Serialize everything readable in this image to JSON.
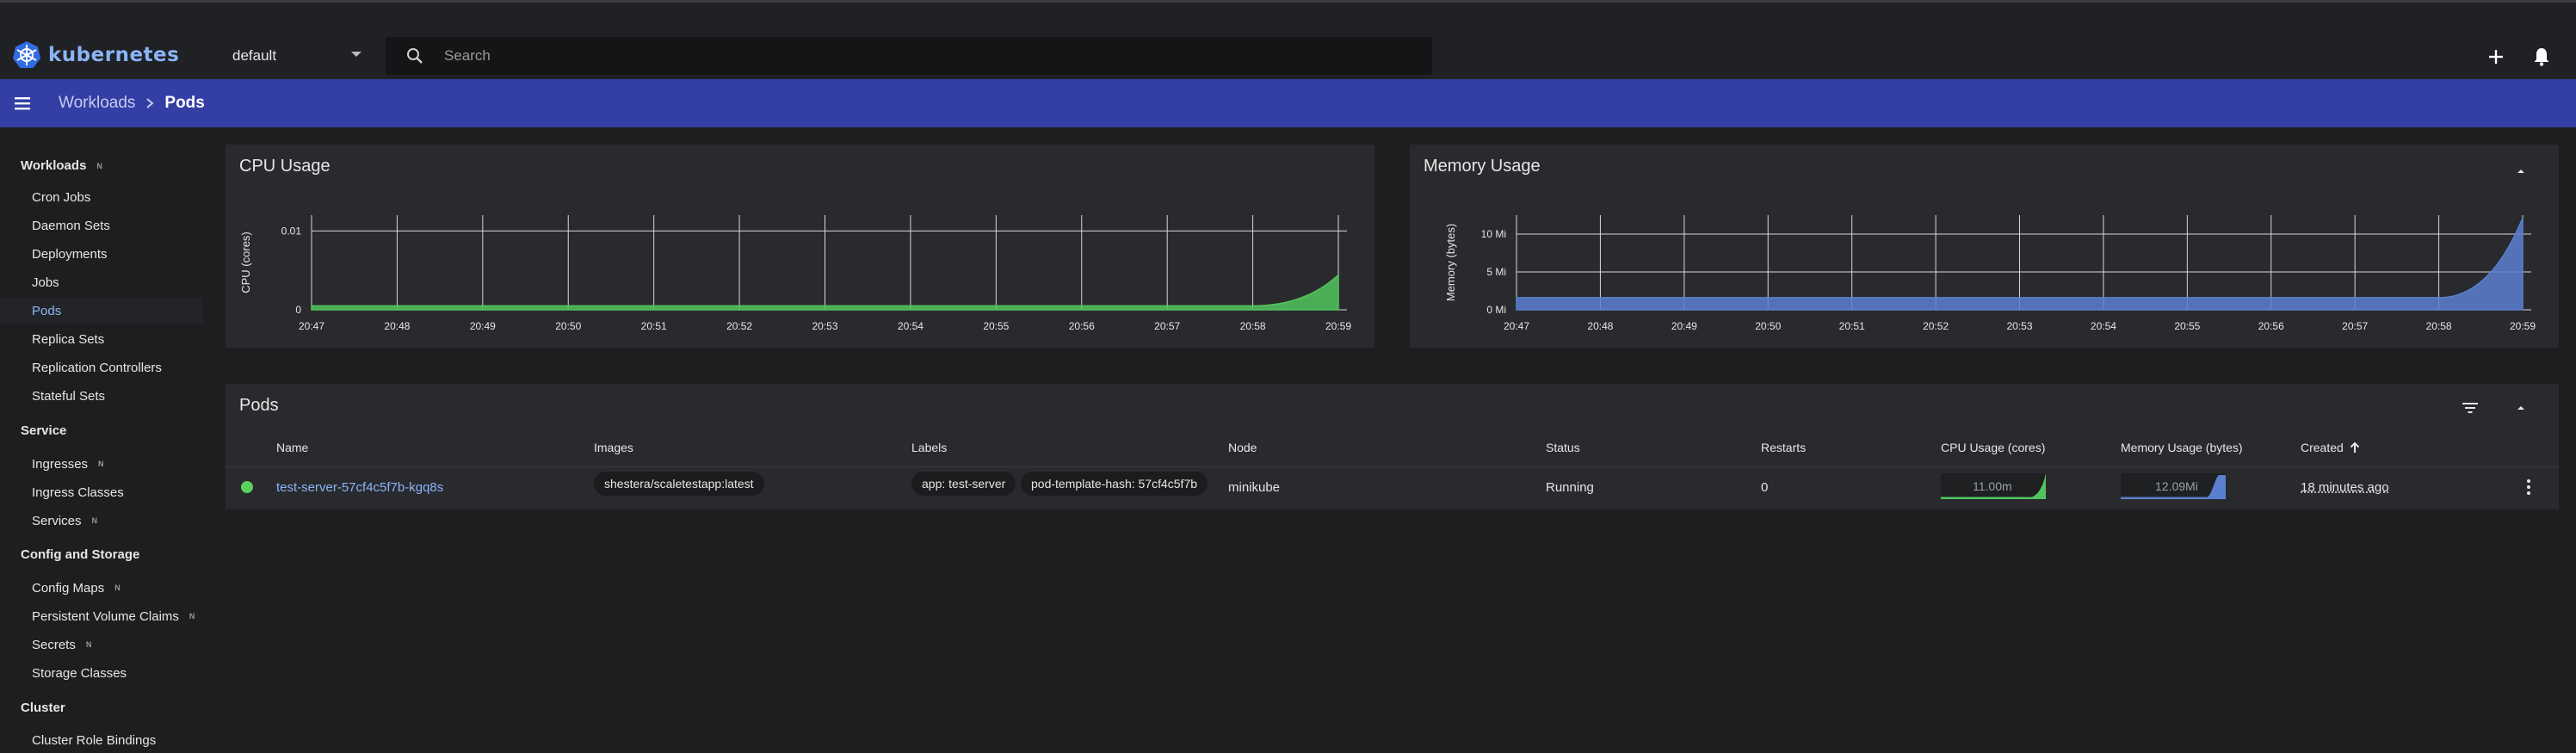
{
  "app": {
    "logo_text": "kubernetes"
  },
  "header": {
    "namespace": "default",
    "search_placeholder": "Search"
  },
  "breadcrumb": {
    "parent": "Workloads",
    "current": "Pods"
  },
  "sidebar": {
    "sections": [
      {
        "label": "Workloads",
        "badge": "N"
      },
      {
        "label": "Service"
      },
      {
        "label": "Config and Storage"
      },
      {
        "label": "Cluster"
      }
    ],
    "items": [
      {
        "label": "Cron Jobs"
      },
      {
        "label": "Daemon Sets"
      },
      {
        "label": "Deployments"
      },
      {
        "label": "Jobs"
      },
      {
        "label": "Pods",
        "active": true
      },
      {
        "label": "Replica Sets"
      },
      {
        "label": "Replication Controllers"
      },
      {
        "label": "Stateful Sets"
      },
      {
        "label": "Ingresses",
        "badge": "N"
      },
      {
        "label": "Ingress Classes"
      },
      {
        "label": "Services",
        "badge": "N"
      },
      {
        "label": "Config Maps",
        "badge": "N"
      },
      {
        "label": "Persistent Volume Claims",
        "badge": "N"
      },
      {
        "label": "Secrets",
        "badge": "N"
      },
      {
        "label": "Storage Classes"
      },
      {
        "label": "Cluster Role Bindings"
      }
    ]
  },
  "cpu_card": {
    "title": "CPU Usage"
  },
  "memory_card": {
    "title": "Memory Usage"
  },
  "chart_data": [
    {
      "type": "area",
      "title": "CPU Usage",
      "ylabel": "CPU (cores)",
      "x": [
        "20:47",
        "20:48",
        "20:49",
        "20:50",
        "20:51",
        "20:52",
        "20:53",
        "20:54",
        "20:55",
        "20:56",
        "20:57",
        "20:58",
        "20:59"
      ],
      "yticks": [
        "0",
        "0.01"
      ],
      "ylim": [
        0,
        0.012
      ],
      "series": [
        {
          "values": [
            0.0005,
            0.0005,
            0.0005,
            0.0005,
            0.0005,
            0.0005,
            0.0005,
            0.0005,
            0.0005,
            0.0005,
            0.0005,
            0.0005,
            0.0044
          ]
        }
      ],
      "color": "#52c45f",
      "grid": true
    },
    {
      "type": "area",
      "title": "Memory Usage",
      "ylabel": "Memory (bytes)",
      "x": [
        "20:47",
        "20:48",
        "20:49",
        "20:50",
        "20:51",
        "20:52",
        "20:53",
        "20:54",
        "20:55",
        "20:56",
        "20:57",
        "20:58",
        "20:59"
      ],
      "yticks": [
        "0 Mi",
        "5 Mi",
        "10 Mi"
      ],
      "ylim": [
        0,
        12.5
      ],
      "series": [
        {
          "values": [
            1.6,
            1.6,
            1.6,
            1.6,
            1.6,
            1.6,
            1.6,
            1.6,
            1.6,
            1.6,
            1.6,
            1.6,
            12.09
          ]
        }
      ],
      "color": "#5b7fd0",
      "grid": true
    }
  ],
  "pods": {
    "title": "Pods",
    "columns": [
      "Name",
      "Images",
      "Labels",
      "Node",
      "Status",
      "Restarts",
      "CPU Usage (cores)",
      "Memory Usage (bytes)",
      "Created"
    ],
    "rows": [
      {
        "name": "test-server-57cf4c5f7b-kgq8s",
        "image": "shestera/scaletestapp:latest",
        "labels": [
          "app: test-server",
          "pod-template-hash: 57cf4c5f7b"
        ],
        "node": "minikube",
        "status": "Running",
        "restarts": "0",
        "cpu": "11.00m",
        "memory": "12.09Mi",
        "created": "18 minutes ago",
        "status_color": "#5bd05b"
      }
    ]
  }
}
